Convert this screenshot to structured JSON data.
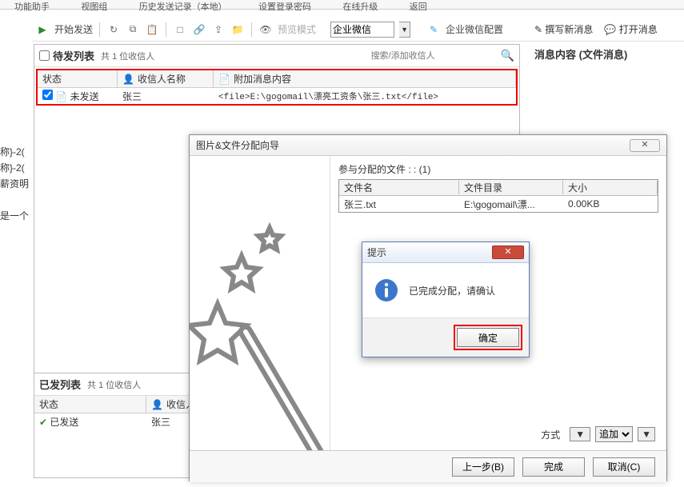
{
  "ribbon": [
    "功能助手",
    "视图组",
    "历史发送记录（本地）",
    "设置登录密码",
    "在线升级",
    "返回"
  ],
  "toolbar": {
    "start_send": "开始发送",
    "preview": "预览模式",
    "combo_value": "企业微信",
    "wx_config": "企业微信配置"
  },
  "pending": {
    "title": "待发列表",
    "count": "共 1 位收信人",
    "search_placeholder": "搜索/添加收信人",
    "cols": {
      "status": "状态",
      "name": "收信人名称",
      "attach": "附加消息内容"
    },
    "row": {
      "status": "未发送",
      "name": "张三",
      "attach": "<file>E:\\gogomail\\漂亮工资条\\张三.txt</file>"
    }
  },
  "sent": {
    "title": "已发列表",
    "count": "共 1 位收信人",
    "cols": {
      "status": "状态",
      "name": "收信人名称"
    },
    "row": {
      "status": "已发送",
      "name": "张三"
    }
  },
  "right": {
    "compose": "撰写新消息",
    "open": "打开消息",
    "title": "消息内容 (文件消息)"
  },
  "leftcut": [
    "称}-2(",
    "称}-2(",
    "薪资明",
    "是一个"
  ],
  "wizard": {
    "title": "图片&文件分配向导",
    "label": "参与分配的文件 : : (1)",
    "cols": {
      "name": "文件名",
      "dir": "文件目录",
      "size": "大小"
    },
    "row": {
      "name": "张三.txt",
      "dir": "E:\\gogomail\\漂...",
      "size": "0.00KB"
    },
    "method_label": "方式",
    "method_arrow": "▼",
    "method_value": "追加",
    "btn_prev": "上一步(B)",
    "btn_done": "完成",
    "btn_cancel": "取消(C)"
  },
  "prompt": {
    "title": "提示",
    "msg": "已完成分配，请确认",
    "ok": "确定"
  }
}
